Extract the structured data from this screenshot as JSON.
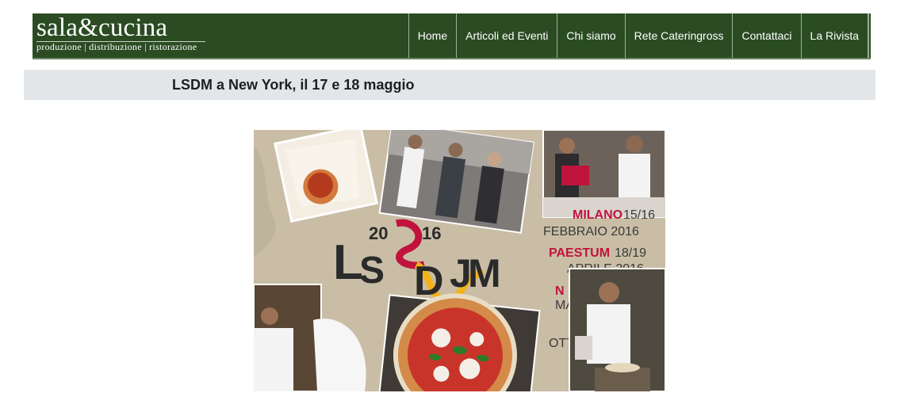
{
  "brand": {
    "name": "sala&cucina",
    "tagline": "produzione | distribuzione | ristorazione"
  },
  "nav": {
    "items": [
      {
        "label": "Home"
      },
      {
        "label": "Articoli ed Eventi"
      },
      {
        "label": "Chi siamo"
      },
      {
        "label": "Rete Cateringross"
      },
      {
        "label": "Contattaci"
      },
      {
        "label": "La Rivista"
      }
    ]
  },
  "page": {
    "title": "LSDM a New York, il 17 e 18 maggio"
  },
  "hero": {
    "logo_year_left": "20",
    "logo_year_right": "16",
    "logo_letters": [
      "L",
      "S",
      "D",
      "J",
      "M"
    ],
    "events": [
      {
        "city": "MILANO",
        "date": "15/16",
        "line2": "FEBBRAIO 2016"
      },
      {
        "city": "PAESTUM",
        "date": "18/19",
        "line2": "APRILE 2016"
      },
      {
        "city": "N",
        "date": "",
        "line2": "MA"
      },
      {
        "city": "",
        "date": "",
        "line2": "OTT"
      }
    ],
    "colors": {
      "background": "#c9bda6",
      "accent_red": "#c0143c",
      "accent_yellow": "#f2b21b",
      "logo_dark": "#2a2a2a",
      "navbar": "#2b4c23"
    }
  }
}
